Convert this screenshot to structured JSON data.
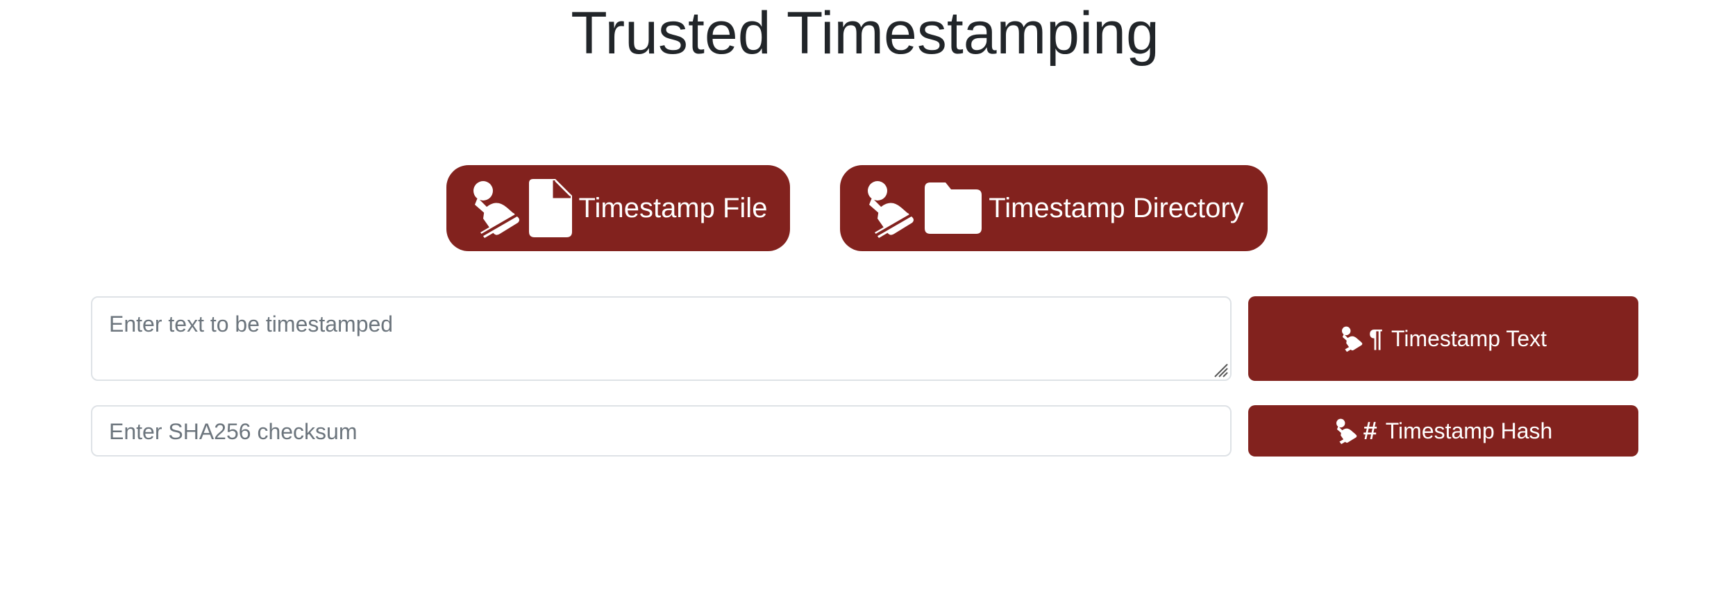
{
  "page": {
    "title": "Trusted Timestamping"
  },
  "actions": {
    "timestamp_file_label": "Timestamp File",
    "timestamp_directory_label": "Timestamp Directory",
    "timestamp_text_label": "Timestamp Text",
    "timestamp_hash_label": "Timestamp Hash"
  },
  "inputs": {
    "text_placeholder": "Enter text to be timestamped",
    "hash_placeholder": "Enter SHA256 checksum",
    "text_value": "",
    "hash_value": ""
  },
  "icons": {
    "stamp": "stamp-icon",
    "file": "file-icon",
    "folder": "folder-icon",
    "paragraph": "paragraph-icon",
    "hash": "hash-icon"
  },
  "glyphs": {
    "paragraph": "¶",
    "hash": "#"
  },
  "colors": {
    "accent": "#82221e",
    "text": "#212529",
    "placeholder": "#6c757d",
    "border": "#dee2e6"
  }
}
